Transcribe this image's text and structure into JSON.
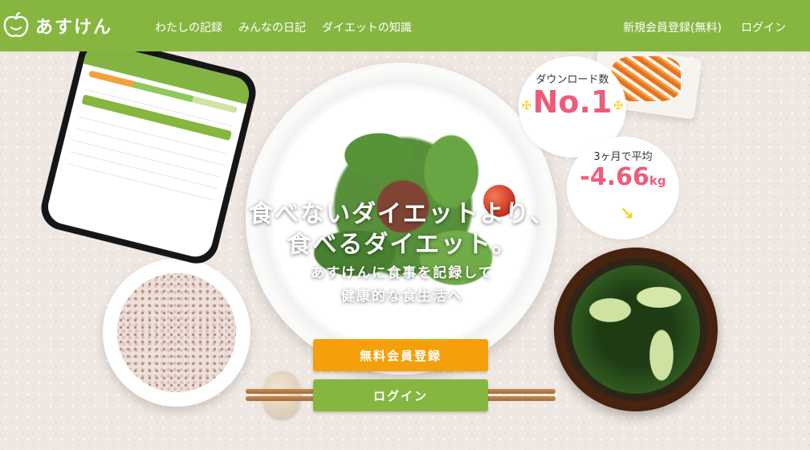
{
  "header": {
    "brand": "あすけん",
    "nav": [
      "わたしの記録",
      "みんなの日記",
      "ダイエットの知識"
    ],
    "signup_link": "新規会員登録(無料)",
    "login_link": "ログイン"
  },
  "hero": {
    "headline_line1": "食べないダイエットより、",
    "headline_line2": "食べるダイエット。",
    "sub_line1": "あすけんに食事を記録して",
    "sub_line2": "健康的な食生活へ"
  },
  "badges": {
    "downloads_label": "ダウンロード数",
    "downloads_value": "No.1",
    "avg_label": "3ヶ月で平均",
    "avg_value": "-4.66",
    "avg_unit": "kg"
  },
  "buttons": {
    "register": "無料会員登録",
    "login": "ログイン"
  },
  "colors": {
    "header_green": "#86b640",
    "register_orange": "#f5a00a",
    "badge_pink": "#ef5c7a",
    "sparkle_yellow": "#f4d31c"
  }
}
